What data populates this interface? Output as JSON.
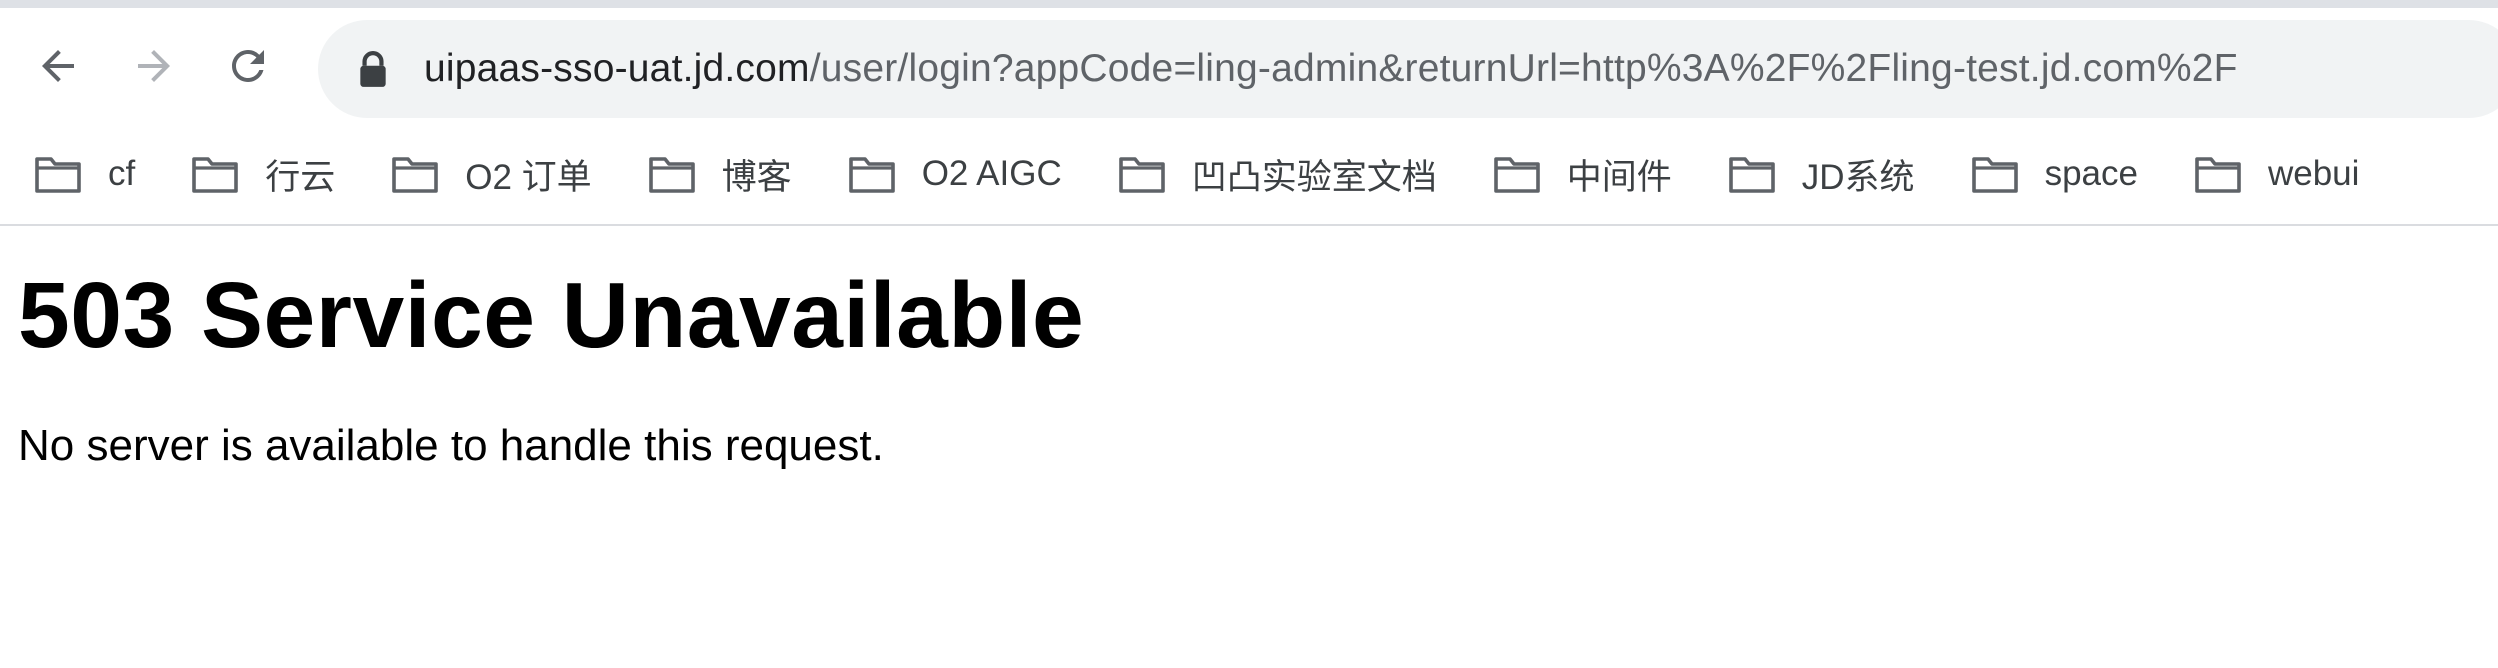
{
  "browser": {
    "nav": {
      "back_icon": "arrow-left-icon",
      "forward_icon": "arrow-right-icon",
      "reload_icon": "reload-icon"
    },
    "address_bar": {
      "lock_icon": "lock-icon",
      "host": "uipaas-sso-uat.jd.com",
      "path": "/user/login?appCode=ling-admin&returnUrl=http%3A%2F%2Fling-test.jd.com%2F"
    },
    "bookmarks": [
      {
        "label": "cf",
        "icon": "folder-icon"
      },
      {
        "label": "行云",
        "icon": "folder-icon"
      },
      {
        "label": "O2 订单",
        "icon": "folder-icon"
      },
      {
        "label": "博客",
        "icon": "folder-icon"
      },
      {
        "label": "O2 AIGC",
        "icon": "folder-icon"
      },
      {
        "label": "凹凸实验室文档",
        "icon": "folder-icon"
      },
      {
        "label": "中间件",
        "icon": "folder-icon"
      },
      {
        "label": "JD系统",
        "icon": "folder-icon"
      },
      {
        "label": "space",
        "icon": "folder-icon"
      },
      {
        "label": "webui",
        "icon": "folder-icon"
      }
    ]
  },
  "page": {
    "heading": "503 Service Unavailable",
    "message": "No server is available to handle this request."
  },
  "colors": {
    "toolbar_bg": "#ffffff",
    "omnibox_bg": "#f1f3f4",
    "icon": "#5f6368",
    "icon_disabled": "#b0b3b8"
  }
}
